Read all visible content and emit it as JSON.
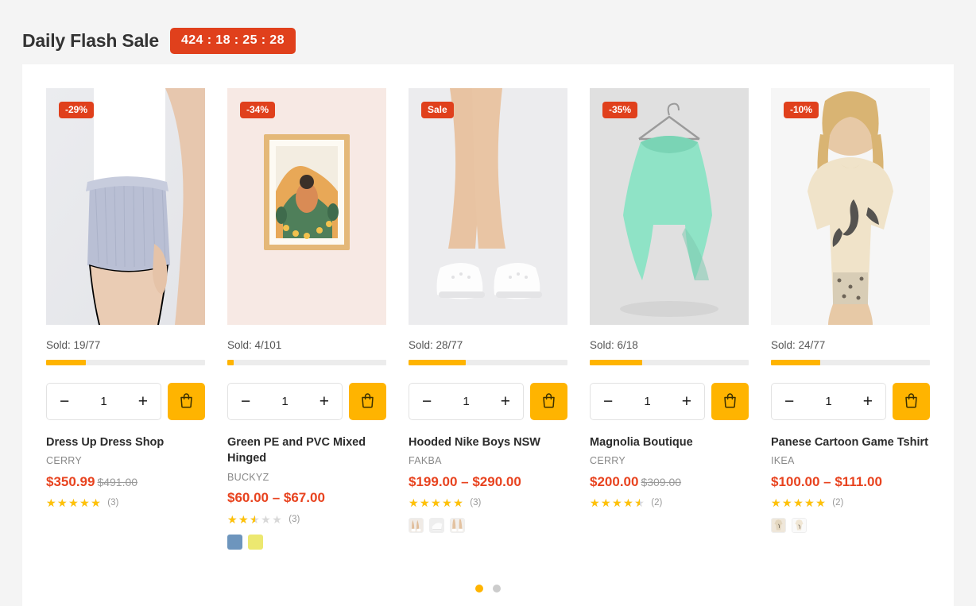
{
  "header": {
    "title": "Daily Flash Sale",
    "countdown": "424 : 18 : 25 : 28"
  },
  "colors": {
    "accent": "#ffb400",
    "sale_red": "#e0401c",
    "price_red": "#e8431f",
    "star": "#ffc107",
    "page_bg": "#f4f4f4",
    "panel_bg": "#ffffff"
  },
  "stepper": {
    "decrement_label": "−",
    "increment_label": "+",
    "quantity": "1",
    "cart_icon": "shopping-bag-icon"
  },
  "products": [
    {
      "badge": "-29%",
      "sold": "Sold: 19/77",
      "progress_percent": 25,
      "title": "Dress Up Dress Shop",
      "vendor": "CERRY",
      "price": "$350.99",
      "old_price": "$491.00",
      "rating": 5,
      "rating_count": "(3)",
      "swatches": []
    },
    {
      "badge": "-34%",
      "sold": "Sold: 4/101",
      "progress_percent": 4,
      "title": "Green PE and PVC Mixed Hinged",
      "vendor": "BUCKYZ",
      "price": "$60.00 – $67.00",
      "old_price": "",
      "rating": 2.5,
      "rating_count": "(3)",
      "swatches": [
        {
          "kind": "color",
          "value": "#6d95bd"
        },
        {
          "kind": "color",
          "value": "#ece870"
        }
      ]
    },
    {
      "badge": "Sale",
      "sold": "Sold: 28/77",
      "progress_percent": 36,
      "title": "Hooded Nike Boys NSW",
      "vendor": "FAKBA",
      "price": "$199.00 – $290.00",
      "old_price": "",
      "rating": 5,
      "rating_count": "(3)",
      "swatches": [
        {
          "kind": "thumb",
          "value": "shoe-thumb-1"
        },
        {
          "kind": "thumb",
          "value": "shoe-thumb-2"
        },
        {
          "kind": "thumb",
          "value": "shoe-thumb-3"
        }
      ]
    },
    {
      "badge": "-35%",
      "sold": "Sold: 6/18",
      "progress_percent": 33,
      "title": "Magnolia Boutique",
      "vendor": "CERRY",
      "price": "$200.00",
      "old_price": "$309.00",
      "rating": 4.5,
      "rating_count": "(2)",
      "swatches": []
    },
    {
      "badge": "-10%",
      "sold": "Sold: 24/77",
      "progress_percent": 31,
      "title": "Panese Cartoon Game Tshirt",
      "vendor": "IKEA",
      "price": "$100.00 – $111.00",
      "old_price": "",
      "rating": 5,
      "rating_count": "(2)",
      "swatches": [
        {
          "kind": "thumb",
          "value": "tshirt-thumb-1"
        },
        {
          "kind": "thumb",
          "value": "tshirt-thumb-2"
        }
      ]
    }
  ],
  "pagination": {
    "dots": [
      {
        "active": true
      },
      {
        "active": false
      }
    ]
  }
}
